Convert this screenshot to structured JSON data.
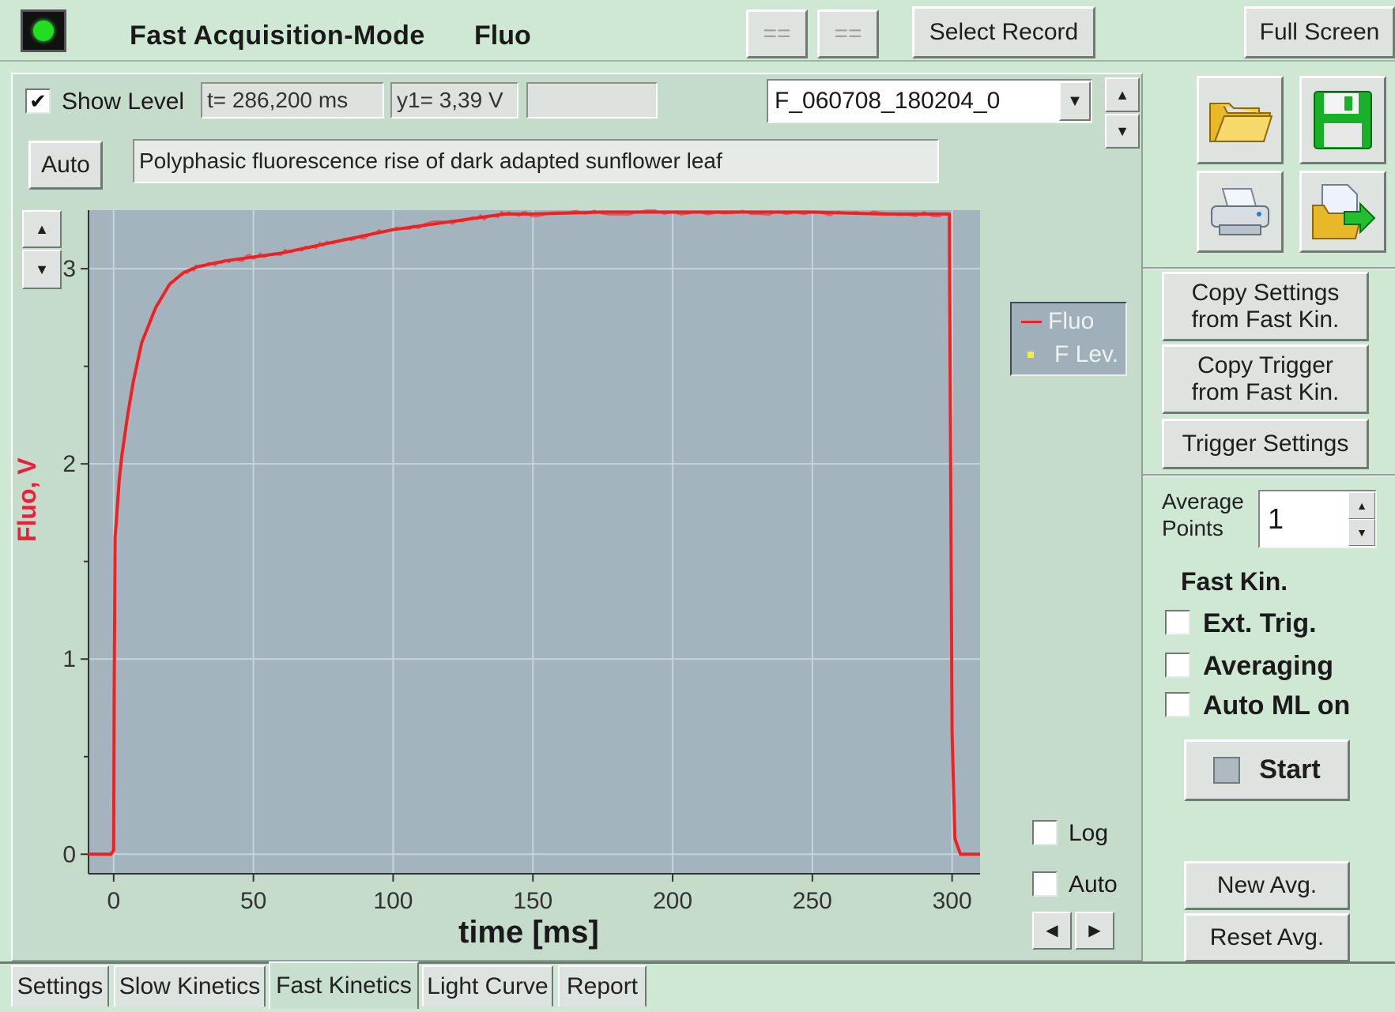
{
  "header": {
    "title": "Fast Acquisition-Mode",
    "mode": "Fluo",
    "nav_prev": "==",
    "nav_next": "==",
    "select_record": "Select Record",
    "full_screen": "Full Screen"
  },
  "toolbar": {
    "show_level_label": "Show Level",
    "show_level_checked": true,
    "t_readout": "t= 286,200 ms",
    "y1_readout": "y1= 3,39 V",
    "extra_readout": "",
    "record_select": "F_060708_180204_0",
    "auto_button": "Auto",
    "description": "Polyphasic fluorescence rise of dark adapted sunflower leaf"
  },
  "icons": {
    "open": "folder-icon",
    "save": "floppy-disk-icon",
    "print": "printer-icon",
    "export": "export-icon"
  },
  "side": {
    "copy_settings": "Copy Settings from Fast Kin.",
    "copy_trigger": "Copy Trigger from Fast Kin.",
    "trigger_settings": "Trigger Settings",
    "average_points_label": "Average Points",
    "average_points_value": "1",
    "fast_kin_heading": "Fast Kin.",
    "ext_trig": "Ext. Trig.",
    "averaging": "Averaging",
    "auto_ml_on": "Auto ML on",
    "start": "Start",
    "new_avg": "New Avg.",
    "reset_avg": "Reset Avg."
  },
  "chart_controls": {
    "log_label": "Log",
    "auto_label": "Auto"
  },
  "legend": {
    "fluo": "Fluo",
    "f_lev": "F Lev."
  },
  "tabs": [
    "Settings",
    "Slow Kinetics",
    "Fast Kinetics",
    "Light Curve",
    "Report"
  ],
  "colors": {
    "trace": "#ee2222",
    "plot_bg": "#a3b4bf",
    "window_bg": "#cfe8d4",
    "axis_label": "#e8203a"
  },
  "chart_data": {
    "type": "line",
    "xlabel": "time [ms]",
    "ylabel": "Fluo, V",
    "xlim": [
      -9,
      310
    ],
    "ylim": [
      -0.1,
      3.3
    ],
    "x_ticks": [
      0,
      50,
      100,
      150,
      200,
      250,
      300
    ],
    "y_ticks": [
      0,
      1,
      2,
      3
    ],
    "grid": true,
    "series": [
      {
        "name": "Fluo",
        "x": [
          -9,
          -1,
          0,
          0.2,
          0.5,
          1,
          2,
          3,
          5,
          7,
          10,
          15,
          20,
          25,
          30,
          40,
          50,
          60,
          70,
          80,
          90,
          100,
          110,
          120,
          130,
          140,
          150,
          175,
          200,
          225,
          250,
          275,
          299,
          300,
          301,
          303,
          310
        ],
        "y": [
          0.0,
          0.0,
          0.02,
          0.85,
          1.62,
          1.72,
          1.92,
          2.05,
          2.25,
          2.42,
          2.62,
          2.8,
          2.92,
          2.98,
          3.01,
          3.04,
          3.06,
          3.08,
          3.11,
          3.14,
          3.17,
          3.2,
          3.22,
          3.24,
          3.26,
          3.28,
          3.28,
          3.29,
          3.29,
          3.29,
          3.29,
          3.28,
          3.28,
          0.62,
          0.08,
          0.0,
          0.0
        ]
      },
      {
        "name": "F Lev.",
        "x": [],
        "y": []
      }
    ],
    "legend": "right"
  }
}
